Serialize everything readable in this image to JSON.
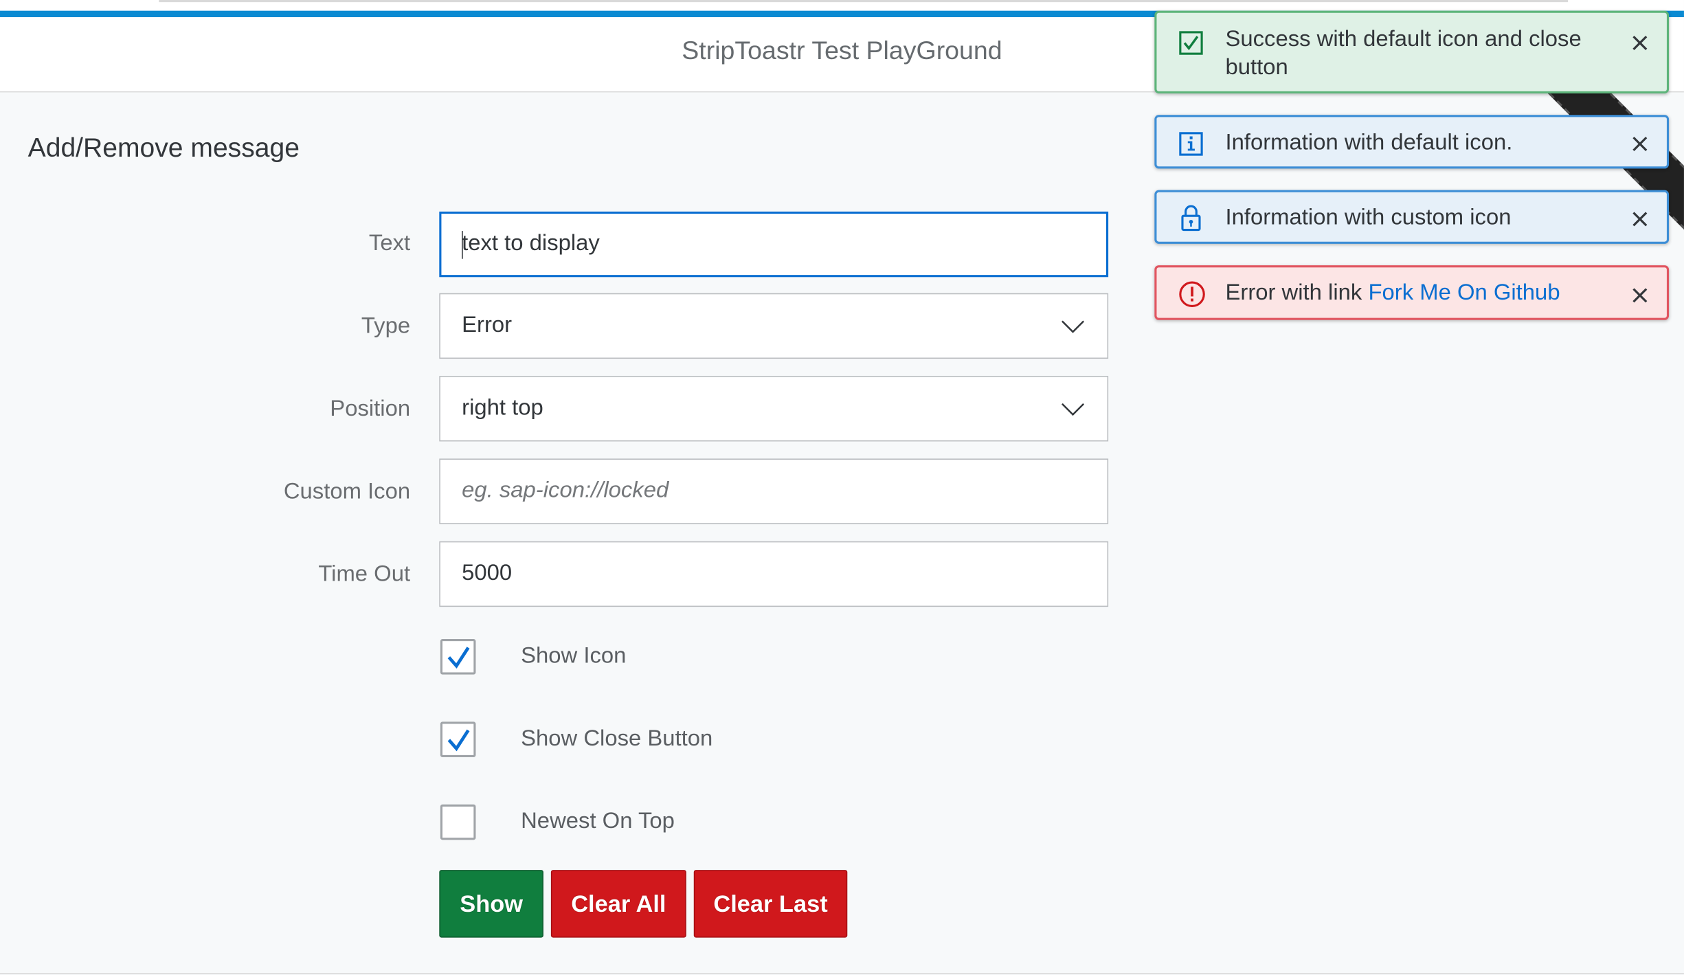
{
  "header": {
    "title": "StripToastr Test PlayGround"
  },
  "section": {
    "title": "Add/Remove message"
  },
  "form": {
    "text": {
      "label": "Text",
      "value": "text to display"
    },
    "type": {
      "label": "Type",
      "value": "Error"
    },
    "position": {
      "label": "Position",
      "value": "right top"
    },
    "custom_icon": {
      "label": "Custom Icon",
      "placeholder": "eg. sap-icon://locked"
    },
    "time_out": {
      "label": "Time Out",
      "value": "5000"
    },
    "checkboxes": [
      {
        "label": "Show Icon",
        "checked": true
      },
      {
        "label": "Show Close Button",
        "checked": true
      },
      {
        "label": "Newest On Top",
        "checked": false
      }
    ]
  },
  "buttons": {
    "show": "Show",
    "clear_all": "Clear All",
    "clear_last": "Clear Last"
  },
  "toasts": [
    {
      "type": "success",
      "text": "Success with default icon and close button",
      "icon": "check-square-icon"
    },
    {
      "type": "info",
      "text": "Information with default icon.",
      "icon": "info-icon"
    },
    {
      "type": "info",
      "text": "Information with custom icon",
      "icon": "lock-icon"
    },
    {
      "type": "error",
      "text": "Error with link",
      "link": "Fork Me On Github",
      "icon": "alert-circle-icon"
    }
  ],
  "colors": {
    "accent": "#0a8ad2",
    "success": "#107e3e",
    "danger": "#d0181c",
    "link": "#0a6ed1"
  }
}
